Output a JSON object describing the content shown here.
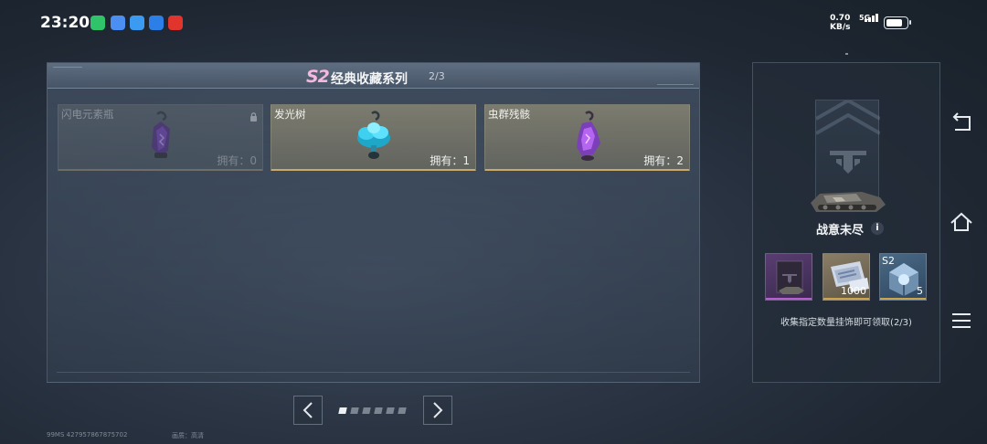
{
  "status_bar": {
    "time": "23:20",
    "network_speed": "0.70",
    "network_unit": "KB/s",
    "signal": "5G",
    "apps": [
      "wechat-icon",
      "app-icon",
      "app-icon",
      "app-icon",
      "app-icon"
    ]
  },
  "collection": {
    "series_badge": "S2",
    "series_title": "经典收藏系列",
    "series_progress": "2/3",
    "items": [
      {
        "name": "闪电元素瓶",
        "count": "拥有：0",
        "locked": true
      },
      {
        "name": "发光树",
        "count": "拥有：1",
        "locked": false
      },
      {
        "name": "虫群残骸",
        "count": "拥有：2",
        "locked": false
      }
    ]
  },
  "pagination": {
    "total_pages": 6,
    "current_page": 1
  },
  "footer": {
    "ping_id": "99MS  427957867875702",
    "quality": "画质：高清"
  },
  "reward": {
    "title": "战意未尽",
    "info_symbol": "i",
    "items": [
      {
        "tag": "",
        "qty": "",
        "ribbon_color": "#b45fd0"
      },
      {
        "tag": "",
        "qty": "1000",
        "ribbon_color": "#c9a24c"
      },
      {
        "tag": "S2",
        "qty": "5",
        "ribbon_color": "#c9a24c"
      }
    ],
    "hint": "收集指定数量挂饰即可领取(2/3)"
  },
  "colors": {
    "accent_gold": "#c9aa6a",
    "s2_pink": "#f5b8de",
    "epic_purple": "#b45fd0"
  }
}
